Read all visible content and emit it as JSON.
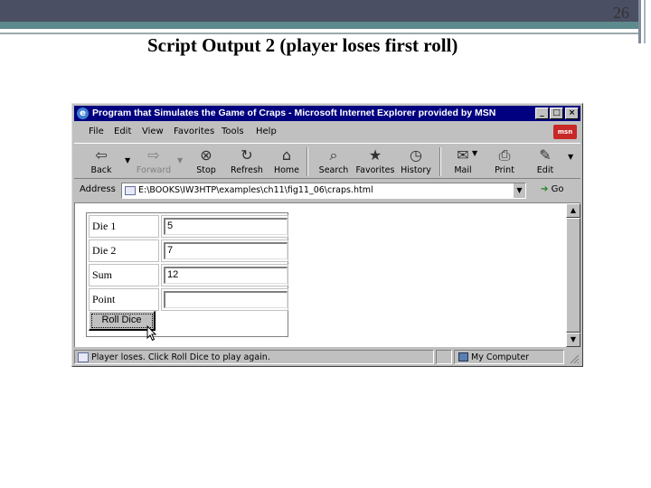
{
  "slide": {
    "number": "26",
    "title": "Script Output 2 (player loses first roll)"
  },
  "window": {
    "title": "Program that Simulates the Game of Craps - Microsoft Internet Explorer provided by MSN",
    "title_buttons": [
      "_",
      "□",
      "×"
    ],
    "brand_badge": "msn"
  },
  "menu": {
    "items": [
      "File",
      "Edit",
      "View",
      "Favorites",
      "Tools",
      "Help"
    ]
  },
  "toolbar": {
    "buttons": [
      {
        "label": "Back",
        "icon": "back-arrow-icon"
      },
      {
        "label": "Forward",
        "icon": "forward-arrow-icon"
      },
      {
        "label": "Stop",
        "icon": "stop-icon"
      },
      {
        "label": "Refresh",
        "icon": "refresh-icon"
      },
      {
        "label": "Home",
        "icon": "home-icon"
      },
      {
        "label": "Search",
        "icon": "search-icon"
      },
      {
        "label": "Favorites",
        "icon": "favorites-icon"
      },
      {
        "label": "History",
        "icon": "history-icon"
      },
      {
        "label": "Mail",
        "icon": "mail-icon"
      },
      {
        "label": "Print",
        "icon": "print-icon"
      },
      {
        "label": "Edit",
        "icon": "edit-icon"
      }
    ]
  },
  "address": {
    "label": "Address",
    "value": "E:\\BOOKS\\IW3HTP\\examples\\ch11\\fig11_06\\craps.html",
    "go_label": "Go"
  },
  "form": {
    "rows": [
      {
        "label": "Die 1",
        "value": "5"
      },
      {
        "label": "Die 2",
        "value": "7"
      },
      {
        "label": "Sum",
        "value": "12"
      },
      {
        "label": "Point",
        "value": ""
      }
    ],
    "button_label": "Roll Dice"
  },
  "status": {
    "message": "Player loses. Click Roll Dice to play again.",
    "zone": "My Computer"
  }
}
